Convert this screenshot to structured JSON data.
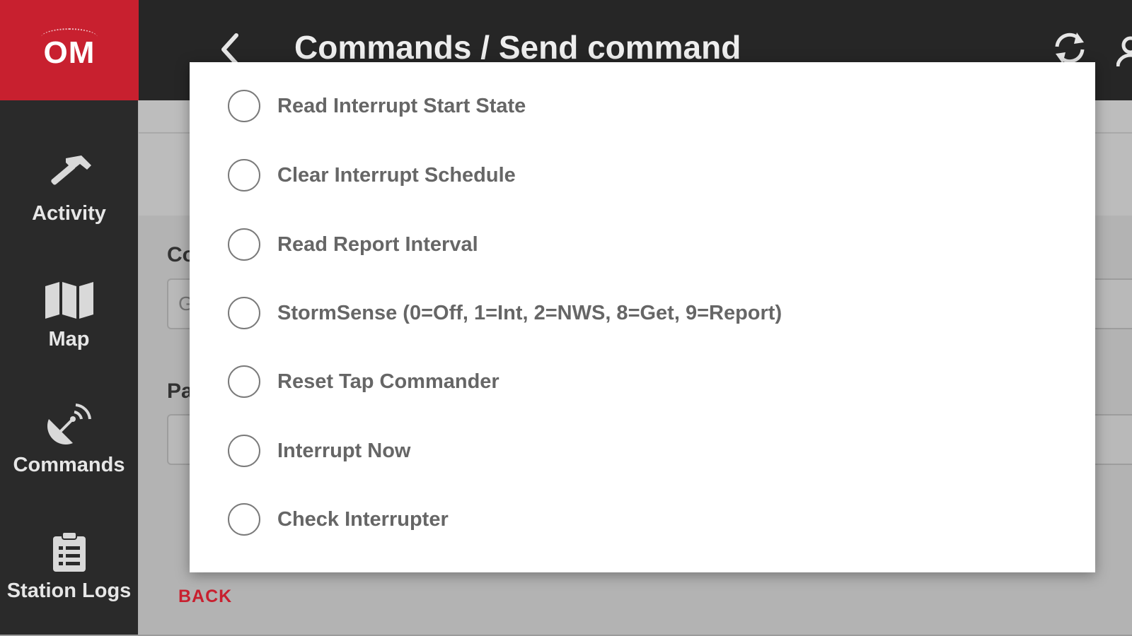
{
  "app": {
    "logo_text": "OM",
    "page_title": "Commands / Send command"
  },
  "colors": {
    "brand_red": "#c8202f",
    "sidebar_bg": "#2a2a2a",
    "topbar_bg": "#262626",
    "overlay_gray": "#b3b3b3"
  },
  "sidebar": {
    "items": [
      {
        "label": "Activity",
        "icon": "hammer-icon"
      },
      {
        "label": "Map",
        "icon": "map-icon"
      },
      {
        "label": "Commands",
        "icon": "satellite-dish-icon"
      },
      {
        "label": "Station Logs",
        "icon": "clipboard-icon"
      }
    ]
  },
  "topbar": {
    "icons": [
      "chevron-left-icon",
      "refresh-icon",
      "person-icon"
    ]
  },
  "background_form": {
    "label_1": "Co",
    "field_1_value": "G",
    "label_2": "Pa",
    "back_label": "BACK"
  },
  "modal": {
    "options": [
      {
        "label": "Read Interrupt Start State",
        "selected": false
      },
      {
        "label": "Clear Interrupt Schedule",
        "selected": false
      },
      {
        "label": "Read Report Interval",
        "selected": false
      },
      {
        "label": "StormSense (0=Off, 1=Int, 2=NWS, 8=Get, 9=Report)",
        "selected": false
      },
      {
        "label": "Reset Tap Commander",
        "selected": false
      },
      {
        "label": "Interrupt Now",
        "selected": false
      },
      {
        "label": "Check Interrupter",
        "selected": false
      }
    ]
  }
}
